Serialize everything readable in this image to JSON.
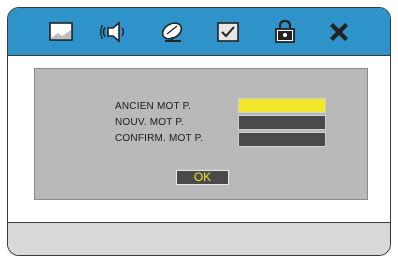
{
  "toolbar": {
    "icons": [
      "screen-icon",
      "audio-speaker-icon",
      "satellite-dish-icon",
      "checklist-icon",
      "padlock-icon",
      "close-x-icon"
    ]
  },
  "password_dialog": {
    "old_password_label": "ANCIEN MOT P.",
    "new_password_label": "NOUV. MOT P.",
    "confirm_password_label": "CONFIRM. MOT P.",
    "ok_label": "OK"
  },
  "colors": {
    "toolbar_bg": "#2e93c8",
    "panel_bg": "#b9b9b9",
    "field_active": "#f2e629",
    "field_inactive": "#4a4a4a",
    "ok_text": "#f2e629"
  }
}
